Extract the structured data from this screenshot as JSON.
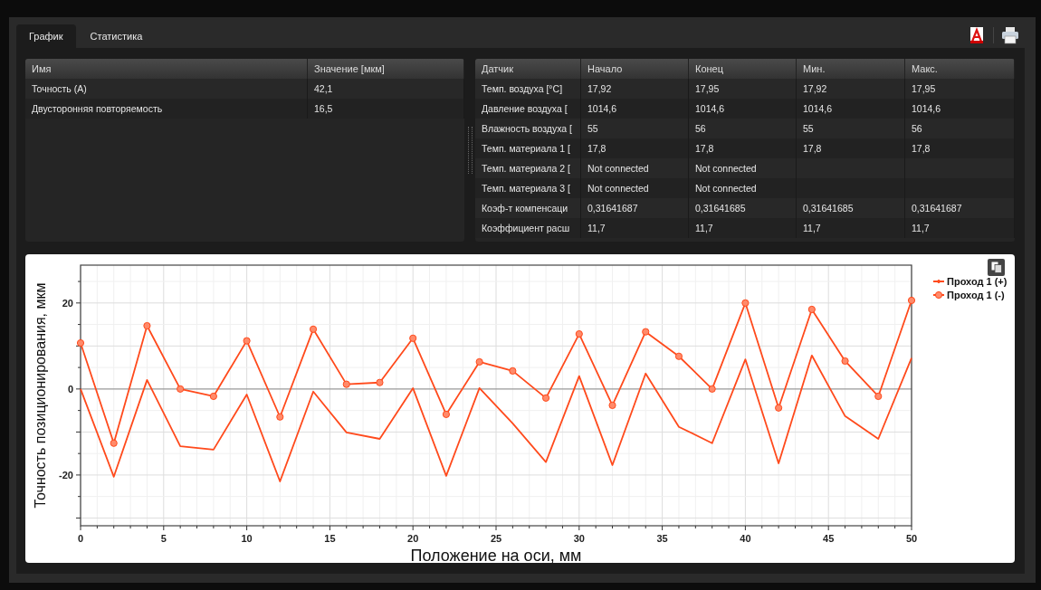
{
  "tabs": [
    {
      "label": "График",
      "selected": true
    },
    {
      "label": "Статистика",
      "selected": false
    }
  ],
  "results_table": {
    "columns": [
      "Имя",
      "Значение [мкм]"
    ],
    "rows": [
      {
        "name": "Точность (A)",
        "value": "42,1"
      },
      {
        "name": "Двусторонняя повторяемость",
        "value": "16,5"
      }
    ]
  },
  "sensor_table": {
    "columns": [
      "Датчик",
      "Начало",
      "Конец",
      "Мин.",
      "Макс."
    ],
    "rows": [
      {
        "sensor": "Темп. воздуха [°C]",
        "values": [
          "17,92",
          "17,95",
          "17,92",
          "17,95"
        ]
      },
      {
        "sensor": "Давление воздуха [",
        "values": [
          "1014,6",
          "1014,6",
          "1014,6",
          "1014,6"
        ]
      },
      {
        "sensor": "Влажность воздуха [",
        "values": [
          "55",
          "56",
          "55",
          "56"
        ]
      },
      {
        "sensor": "Темп. материала 1 [",
        "values": [
          "17,8",
          "17,8",
          "17,8",
          "17,8"
        ]
      },
      {
        "sensor": "Темп. материала 2 [",
        "values": [
          "Not connected",
          "Not connected"
        ]
      },
      {
        "sensor": "Темп. материала 3 [",
        "values": [
          "Not connected",
          "Not connected"
        ]
      },
      {
        "sensor": "Коэф-т компенсаци",
        "values": [
          "0,31641687",
          "0,31641685",
          "0,31641685",
          "0,31641687"
        ]
      },
      {
        "sensor": "Коэффициент расш",
        "values": [
          "11,7",
          "11,7",
          "11,7",
          "11,7"
        ]
      }
    ]
  },
  "chart": {
    "chart_data": {
      "type": "line",
      "xlabel": "Положение на оси, мм",
      "ylabel": "Точность позиционирования, мкм",
      "x": [
        0,
        2,
        4,
        6,
        8,
        10,
        12,
        14,
        16,
        18,
        20,
        22,
        24,
        26,
        28,
        30,
        32,
        34,
        36,
        38,
        40,
        42,
        44,
        46,
        48,
        50
      ],
      "grid": true,
      "legend": true,
      "xlim": [
        0,
        50
      ],
      "ylim": [
        -31.8,
        28.8
      ],
      "xticks": [
        0,
        5,
        10,
        15,
        20,
        25,
        30,
        35,
        40,
        45,
        50
      ],
      "yticks": [
        -20,
        0,
        20
      ],
      "series": [
        {
          "name": "Проход 1 (+)",
          "color": "#ff4a1c",
          "marker": "none",
          "values": [
            0,
            -20.4,
            2.1,
            -13.3,
            -14.1,
            -1.3,
            -21.5,
            -0.6,
            -10.1,
            -11.6,
            0.2,
            -20.2,
            0.2,
            -8,
            -17,
            3,
            -17.7,
            3.6,
            -8.8,
            -12.6,
            6.9,
            -17.3,
            7.8,
            -6.3,
            -11.6,
            7.2
          ]
        },
        {
          "name": "Проход 1 (-)",
          "color": "#ff4a1c",
          "marker": "circle",
          "values": [
            10.7,
            -12.6,
            14.7,
            0,
            -1.7,
            11.2,
            -6.5,
            13.9,
            1.1,
            1.5,
            11.8,
            -5.9,
            6.3,
            4.2,
            -2.1,
            12.8,
            -3.8,
            13.3,
            7.6,
            0,
            20,
            -4.4,
            18.5,
            6.5,
            -1.7,
            20.6
          ]
        }
      ]
    }
  }
}
